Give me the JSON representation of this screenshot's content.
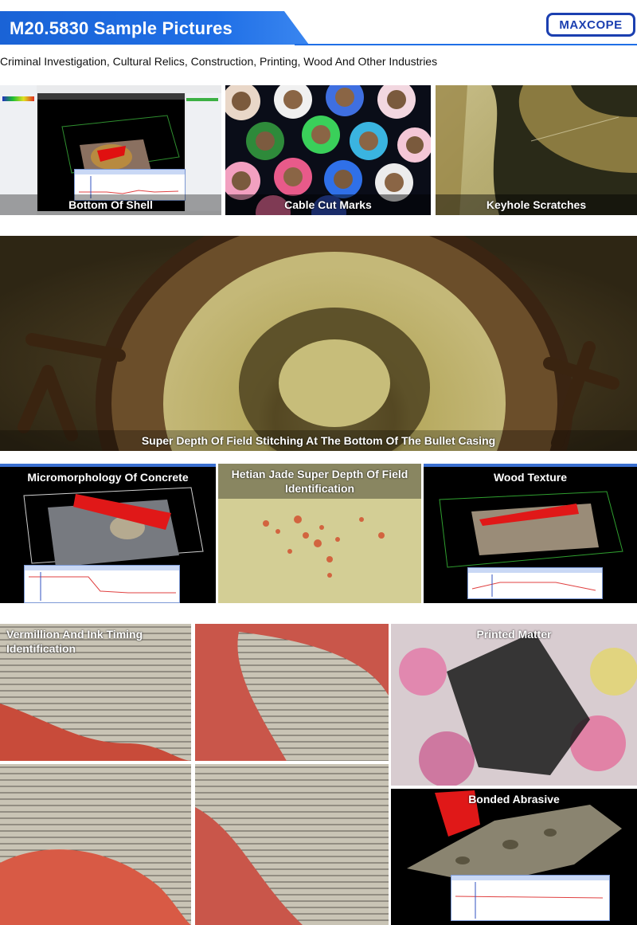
{
  "header": {
    "title": "M20.5830 Sample Pictures",
    "logo": "MAXCOPE",
    "subtitle": "Criminal Investigation, Cultural Relics, Construction, Printing, Wood And Other Industries",
    "accent_color": "#1f6fe6",
    "logo_color": "#1b3fb0"
  },
  "tiles": {
    "bottom_of_shell": "Bottom Of Shell",
    "cable_cut_marks": "Cable Cut Marks",
    "keyhole_scratches": "Keyhole Scratches",
    "bullet_casing": "Super Depth Of Field Stitching At The Bottom Of The Bullet Casing",
    "concrete": "Micromorphology Of Concrete",
    "jade": "Hetian Jade Super Depth Of Field Identification",
    "wood": "Wood Texture",
    "vermillion": "Vermillion And Ink Timing Identification",
    "printed": "Printed Matter",
    "abrasive": "Bonded Abrasive"
  }
}
